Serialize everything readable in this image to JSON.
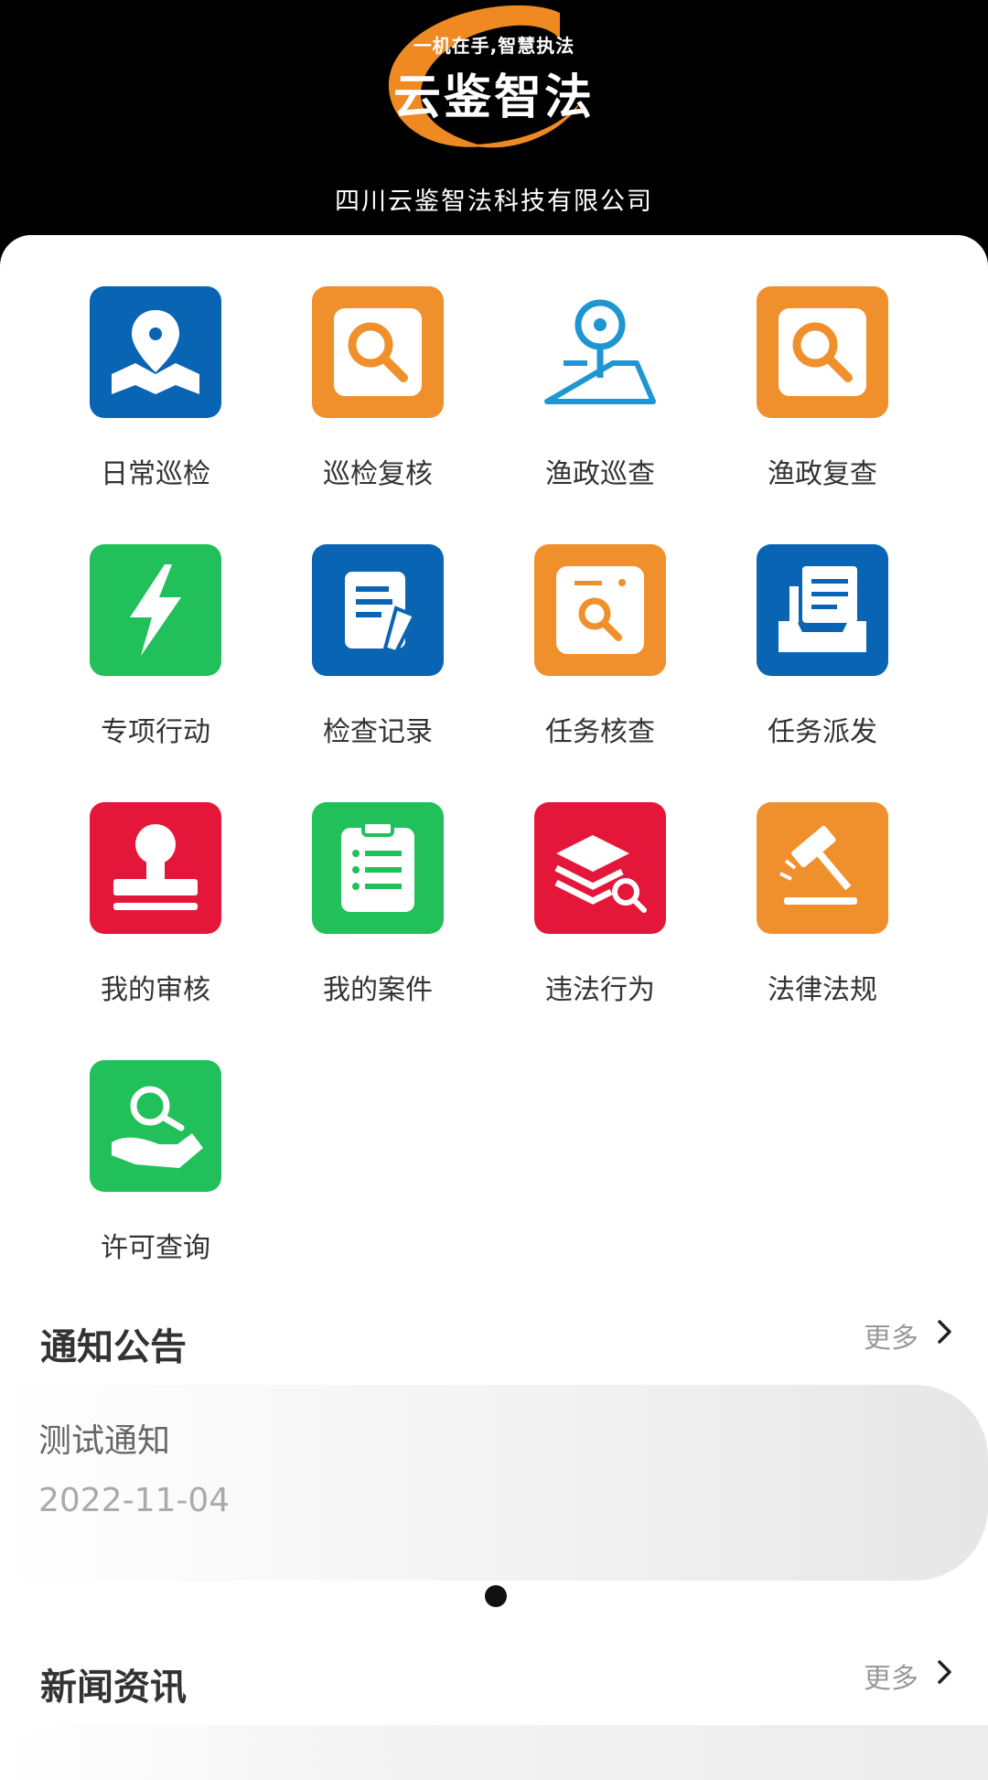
{
  "header": {
    "slogan": "一机在手,智慧执法",
    "brand": "云鉴智法",
    "company": "四川云鉴智法科技有限公司"
  },
  "grid": [
    {
      "label": "日常巡检",
      "icon": "map-pin-icon",
      "color": "#0a64b4"
    },
    {
      "label": "巡检复核",
      "icon": "search-icon",
      "color": "#f0902c"
    },
    {
      "label": "渔政巡查",
      "icon": "location-pin-icon",
      "color": "#ffffff"
    },
    {
      "label": "渔政复查",
      "icon": "search-icon",
      "color": "#f0902c"
    },
    {
      "label": "专项行动",
      "icon": "lightning-icon",
      "color": "#22c05a"
    },
    {
      "label": "检查记录",
      "icon": "document-edit-icon",
      "color": "#0a64b4"
    },
    {
      "label": "任务核查",
      "icon": "inspect-icon",
      "color": "#f0902c"
    },
    {
      "label": "任务派发",
      "icon": "inbox-icon",
      "color": "#0a64b4"
    },
    {
      "label": "我的审核",
      "icon": "stamp-icon",
      "color": "#e4173a"
    },
    {
      "label": "我的案件",
      "icon": "clipboard-icon",
      "color": "#22c05a"
    },
    {
      "label": "违法行为",
      "icon": "layers-search-icon",
      "color": "#e4173a"
    },
    {
      "label": "法律法规",
      "icon": "gavel-icon",
      "color": "#f0902c"
    },
    {
      "label": "许可查询",
      "icon": "hand-search-icon",
      "color": "#22c05a"
    }
  ],
  "notice": {
    "title": "通知公告",
    "more": "更多",
    "item_title": "测试通知",
    "item_date": "2022-11-04"
  },
  "news": {
    "title": "新闻资讯",
    "more": "更多"
  }
}
